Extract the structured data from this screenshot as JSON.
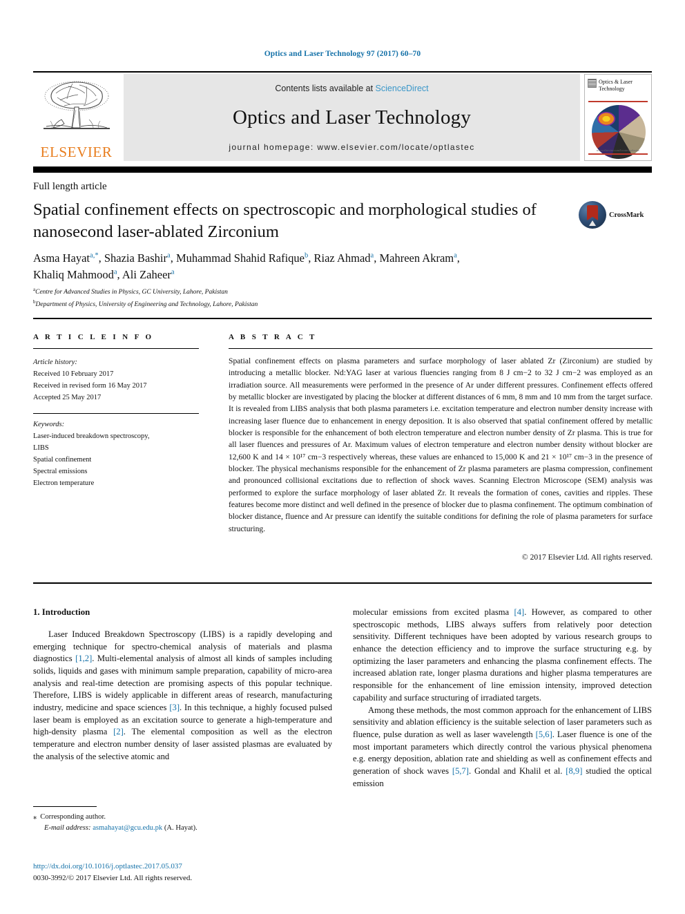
{
  "running_head": "Optics and Laser Technology 97 (2017) 60–70",
  "masthead": {
    "publisher_name": "ELSEVIER",
    "contents_prefix": "Contents lists available at ",
    "contents_link": "ScienceDirect",
    "journal_title": "Optics and Laser Technology",
    "homepage": "journal homepage: www.elsevier.com/locate/optlastec",
    "cover_title": "Optics & Laser Technology",
    "cover_caption": "www.elsevier.com/locate/optlastec"
  },
  "article_type": "Full length article",
  "title": "Spatial confinement effects on spectroscopic and morphological studies of nanosecond laser-ablated Zirconium",
  "crossmark_label": "CrossMark",
  "authors": [
    {
      "name": "Asma Hayat",
      "marks": "a,*"
    },
    {
      "name": "Shazia Bashir",
      "marks": "a"
    },
    {
      "name": "Muhammad Shahid Rafique",
      "marks": "b"
    },
    {
      "name": "Riaz Ahmad",
      "marks": "a"
    },
    {
      "name": "Mahreen Akram",
      "marks": "a"
    },
    {
      "name": "Khaliq Mahmood",
      "marks": "a"
    },
    {
      "name": "Ali Zaheer",
      "marks": "a"
    }
  ],
  "affiliations": [
    {
      "mark": "a",
      "text": "Centre for Advanced Studies in Physics, GC University, Lahore, Pakistan"
    },
    {
      "mark": "b",
      "text": "Department of Physics, University of Engineering and Technology, Lahore, Pakistan"
    }
  ],
  "headings": {
    "article_info": "A R T I C L E   I N F O",
    "abstract": "A B S T R A C T"
  },
  "article_history": {
    "label": "Article history:",
    "lines": [
      "Received 10 February 2017",
      "Received in revised form 16 May 2017",
      "Accepted 25 May 2017"
    ]
  },
  "keywords": {
    "label": "Keywords:",
    "items": [
      "Laser-induced breakdown spectroscopy,",
      "LIBS",
      "Spatial confinement",
      "Spectral emissions",
      "Electron temperature"
    ]
  },
  "abstract_text": "Spatial confinement effects on plasma parameters and surface morphology of laser ablated Zr (Zirconium) are studied by introducing a metallic blocker. Nd:YAG laser at various fluencies ranging from 8 J cm−2 to 32 J cm−2 was employed as an irradiation source. All measurements were performed in the presence of Ar under different pressures. Confinement effects offered by metallic blocker are investigated by placing the blocker at different distances of 6 mm, 8 mm and 10 mm from the target surface. It is revealed from LIBS analysis that both plasma parameters i.e. excitation temperature and electron number density increase with increasing laser fluence due to enhancement in energy deposition. It is also observed that spatial confinement offered by metallic blocker is responsible for the enhancement of both electron temperature and electron number density of Zr plasma. This is true for all laser fluences and pressures of Ar. Maximum values of electron temperature and electron number density without blocker are 12,600 K and 14 × 10¹⁷ cm−3 respectively whereas, these values are enhanced to 15,000 K and 21 × 10¹⁷ cm−3 in the presence of blocker. The physical mechanisms responsible for the enhancement of Zr plasma parameters are plasma compression, confinement and pronounced collisional excitations due to reflection of shock waves. Scanning Electron Microscope (SEM) analysis was performed to explore the surface morphology of laser ablated Zr. It reveals the formation of cones, cavities and ripples. These features become more distinct and well defined in the presence of blocker due to plasma confinement. The optimum combination of blocker distance, fluence and Ar pressure can identify the suitable conditions for defining the role of plasma parameters for surface structuring.",
  "copyright": "© 2017 Elsevier Ltd. All rights reserved.",
  "section_heading": "1. Introduction",
  "body": {
    "left_para_1": "Laser Induced Breakdown Spectroscopy (LIBS) is a rapidly developing and emerging technique for spectro-chemical analysis of materials and plasma diagnostics [1,2]. Multi-elemental analysis of almost all kinds of samples including solids, liquids and gases with minimum sample preparation, capability of micro-area analysis and real-time detection are promising aspects of this popular technique. Therefore, LIBS is widely applicable in different areas of research, manufacturing industry, medicine and space sciences [3]. In this technique, a highly focused pulsed laser beam is employed as an excitation source to generate a high-temperature and high-density plasma [2]. The elemental composition as well as the electron temperature and electron number density of laser assisted plasmas are evaluated by the analysis of the selective atomic and",
    "right_para_1": "molecular emissions from excited plasma [4]. However, as compared to other spectroscopic methods, LIBS always suffers from relatively poor detection sensitivity. Different techniques have been adopted by various research groups to enhance the detection efficiency and to improve the surface structuring e.g. by optimizing the laser parameters and enhancing the plasma confinement effects. The increased ablation rate, longer plasma durations and higher plasma temperatures are responsible for the enhancement of line emission intensity, improved detection capability and surface structuring of irradiated targets.",
    "right_para_2": "Among these methods, the most common approach for the enhancement of LIBS sensitivity and ablation efficiency is the suitable selection of laser parameters such as fluence, pulse duration as well as laser wavelength [5,6]. Laser fluence is one of the most important parameters which directly control the various physical phenomena e.g. energy deposition, ablation rate and shielding as well as confinement effects and generation of shock waves [5,7]. Gondal and Khalil et al. [8,9] studied the optical emission"
  },
  "footnote": {
    "corresponding": "Corresponding author.",
    "email_label": "E-mail address:",
    "email": "asmahayat@gcu.edu.pk",
    "email_suffix": "(A. Hayat).",
    "doi": "http://dx.doi.org/10.1016/j.optlastec.2017.05.037",
    "issn_line": "0030-3992/© 2017 Elsevier Ltd. All rights reserved."
  },
  "colors": {
    "link": "#1471a8",
    "sciencedirect": "#3a97c9",
    "elsevier_orange": "#e87d1e",
    "band_gray": "#e6e6e6"
  }
}
